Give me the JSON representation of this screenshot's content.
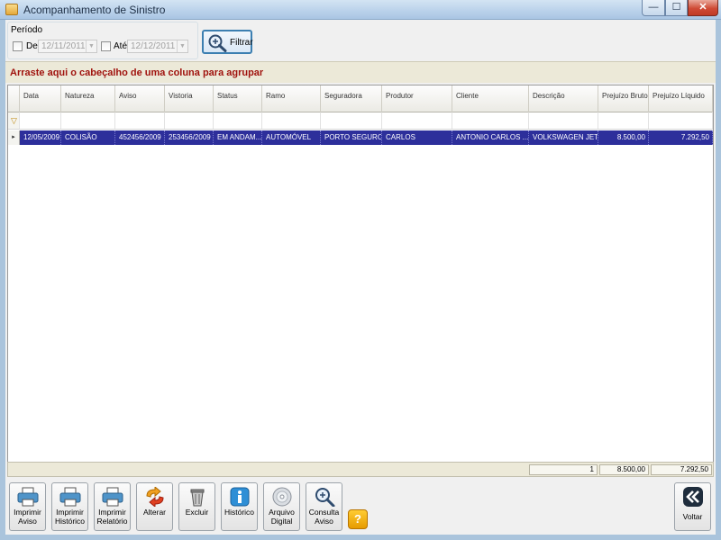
{
  "window": {
    "title": "Acompanhamento de Sinistro",
    "controls": {
      "minimize": "—",
      "maximize": "☐",
      "close": "✕"
    }
  },
  "period": {
    "label": "Período",
    "from_label": "De",
    "from_value": "12/11/2011",
    "to_label": "Até",
    "to_value": "12/12/2011",
    "filter_button": "Filtrar"
  },
  "group_panel": "Arraste aqui o cabeçalho de uma coluna para agrupar",
  "grid": {
    "columns": [
      "Data",
      "Natureza",
      "Aviso",
      "Vistoria",
      "Status",
      "Ramo",
      "Seguradora",
      "Produtor",
      "Cliente",
      "Descrição",
      "Prejuízo Bruto",
      "Prejuízo Líquido"
    ],
    "rows": [
      [
        "12/05/2009",
        "COLISÃO",
        "452456/2009",
        "253456/2009",
        "EM ANDAM...",
        "AUTOMÓVEL",
        "PORTO SEGURO",
        "CARLOS",
        "ANTONIO CARLOS ...",
        "VOLKSWAGEN JET...",
        "8.500,00",
        "7.292,50"
      ]
    ],
    "summary": {
      "count": "1",
      "bruto": "8.500,00",
      "liquido": "7.292,50"
    }
  },
  "toolbar": {
    "imprimir_aviso": "Imprimir Aviso",
    "imprimir_historico": "Imprimir Histórico",
    "imprimir_relatorio": "Imprimir Relatório",
    "alterar": "Alterar",
    "excluir": "Excluir",
    "historico": "Histórico",
    "arquivo_digital": "Arquivo Digital",
    "consulta_aviso": "Consulta Aviso",
    "help": "?",
    "voltar": "Voltar"
  },
  "icons": {
    "printer": "printer-icon",
    "edit": "refresh-arrows-icon",
    "delete": "trash-icon",
    "history": "info-icon",
    "disc": "cd-icon",
    "search": "magnifier-icon",
    "back": "double-chevron-left-icon"
  },
  "colors": {
    "selected_row": "#2d2f9b",
    "group_panel_text": "#a0130e"
  }
}
